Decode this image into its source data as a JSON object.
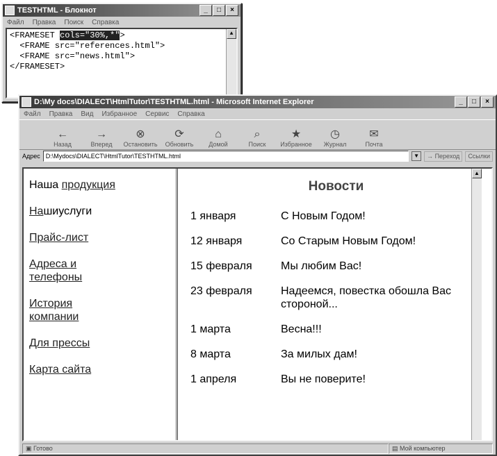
{
  "notepad": {
    "title": "TESTHTML - Блокнот",
    "menu": [
      "Файл",
      "Правка",
      "Поиск",
      "Справка"
    ],
    "code": {
      "line1_prefix": "<FRAMESET ",
      "line1_highlight": "cols=\"30%,*\"",
      "line1_suffix": ">",
      "line2": "  <FRAME src=\"references.html\">",
      "line3": "  <FRAME src=\"news.html\">",
      "line4": "</FRAMESET>"
    }
  },
  "browser": {
    "title": "D:\\My docs\\DIALECT\\HtmlTutor\\TESTHTML.html - Microsoft Internet Explorer",
    "menu": [
      "Файл",
      "Правка",
      "Вид",
      "Избранное",
      "Сервис",
      "Справка"
    ],
    "toolbar": [
      {
        "icon": "back-arrow",
        "label": "Назад"
      },
      {
        "icon": "forward-arrow",
        "label": "Вперед"
      },
      {
        "icon": "stop",
        "label": "Остановить"
      },
      {
        "icon": "refresh",
        "label": "Обновить"
      },
      {
        "icon": "home",
        "label": "Домой"
      },
      {
        "icon": "search",
        "label": "Поиск"
      },
      {
        "icon": "favorites",
        "label": "Избранное"
      },
      {
        "icon": "history",
        "label": "Журнал"
      },
      {
        "icon": "mail",
        "label": "Почта"
      }
    ],
    "address_label": "Адрес",
    "address_value": "D:\\Mydocs\\DIALECT\\HtmlTutor\\TESTHTML.html",
    "go_label": "Переход",
    "links_label": "Ссылки",
    "status_left": "Готово",
    "status_right": "Мой компьютер"
  },
  "nav": {
    "item1_plain": "Наша ",
    "item1_link": "продукция",
    "item2_link": "На",
    "item2_plain": "шиуслуги",
    "item3": "Прайс-лист",
    "item4_line1": "Адреса и",
    "item4_line2": "телефоны",
    "item5_line1": "История",
    "item5_line2": "компании",
    "item6": "Для прессы",
    "item7": "Карта сайта"
  },
  "news": {
    "title": "Новости",
    "rows": [
      {
        "date": "1 января",
        "text": "С Новым Годом!"
      },
      {
        "date": "12 января",
        "text": "Со Старым Новым Годом!"
      },
      {
        "date": "15 февраля",
        "text": "Мы любим Вас!"
      },
      {
        "date": "23 февраля",
        "text": "Надеемся, повестка обошла Вас стороной..."
      },
      {
        "date": "1 марта",
        "text": "Весна!!!"
      },
      {
        "date": "8 марта",
        "text": "За милых дам!"
      },
      {
        "date": "1 апреля",
        "text": "Вы не поверите!"
      }
    ]
  }
}
